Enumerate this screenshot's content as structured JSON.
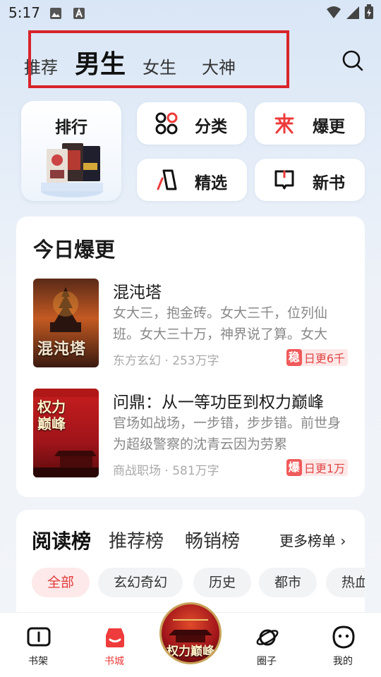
{
  "status_bar": {
    "time": "5:17"
  },
  "top_tabs": [
    "推荐",
    "男生",
    "女生",
    "大神"
  ],
  "quick_grid": {
    "rank_label": "排行",
    "buttons": [
      "分类",
      "爆更",
      "精选",
      "新书"
    ]
  },
  "today_update": {
    "title": "今日爆更",
    "books": [
      {
        "title": "混沌塔",
        "desc": "女大三，抱金砖。女大三千，位列仙班。女大三十万，神界说了算。女大",
        "genre": "东方玄幻",
        "words": "253万字",
        "badge_tag": "稳",
        "badge_text": "日更6千",
        "cover_text": "混沌塔"
      },
      {
        "title": "问鼎：从一等功臣到权力巅峰",
        "desc": "官场如战场，一步错，步步错。前世身为超级警察的沈青云因为劳累",
        "genre": "商战职场",
        "words": "581万字",
        "badge_tag": "爆",
        "badge_text": "日更1万",
        "cover_text": "权力巅峰"
      }
    ]
  },
  "rank_section": {
    "tabs": [
      "阅读榜",
      "推荐榜",
      "畅销榜"
    ],
    "more": "更多榜单",
    "chips": [
      "全部",
      "玄幻奇幻",
      "历史",
      "都市",
      "热血"
    ]
  },
  "bottom_nav": [
    "书架",
    "书城",
    "圈子",
    "我的"
  ],
  "colors": {
    "accent_red": "#ee3b3b",
    "highlight_box": "#d8242b"
  }
}
